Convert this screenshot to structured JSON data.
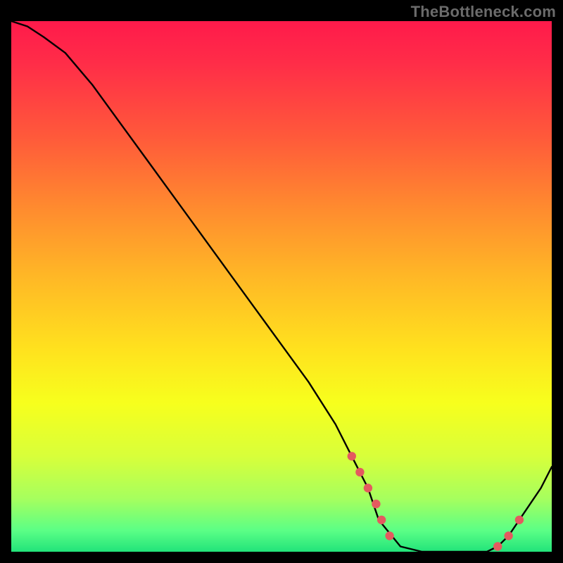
{
  "watermark": "TheBottleneck.com",
  "colors": {
    "dot": "#e45a5f",
    "curve": "#000000",
    "frame": "#000000"
  },
  "chart_data": {
    "type": "line",
    "title": "",
    "xlabel": "",
    "ylabel": "",
    "xlim": [
      0,
      100
    ],
    "ylim": [
      0,
      100
    ],
    "grid": false,
    "legend": false,
    "note": "Bottleneck-style curve: high at left, descends roughly linearly, flat basin near x≈68–90, climbs again at right. Y encodes bottleneck severity (100=red top, 0=green bottom). No axis ticks shown in source.",
    "series": [
      {
        "name": "bottleneck-curve",
        "x": [
          0,
          3,
          6,
          10,
          15,
          20,
          25,
          30,
          35,
          40,
          45,
          50,
          55,
          60,
          63,
          66,
          68,
          72,
          76,
          80,
          84,
          88,
          90,
          92,
          94,
          96,
          98,
          100
        ],
        "values": [
          100,
          99,
          97,
          94,
          88,
          81,
          74,
          67,
          60,
          53,
          46,
          39,
          32,
          24,
          18,
          12,
          6,
          1,
          0,
          0,
          0,
          0,
          1,
          3,
          6,
          9,
          12,
          16
        ]
      }
    ],
    "markers": {
      "name": "highlight-dots",
      "note": "Salmon dots along the lower portion of the curve on both the descending side near the basin and the ascending right side.",
      "x": [
        63,
        64.5,
        66,
        67.5,
        68.5,
        70,
        90,
        92,
        94
      ],
      "values": [
        18,
        15,
        12,
        9,
        6,
        3,
        1,
        3,
        6
      ]
    }
  }
}
